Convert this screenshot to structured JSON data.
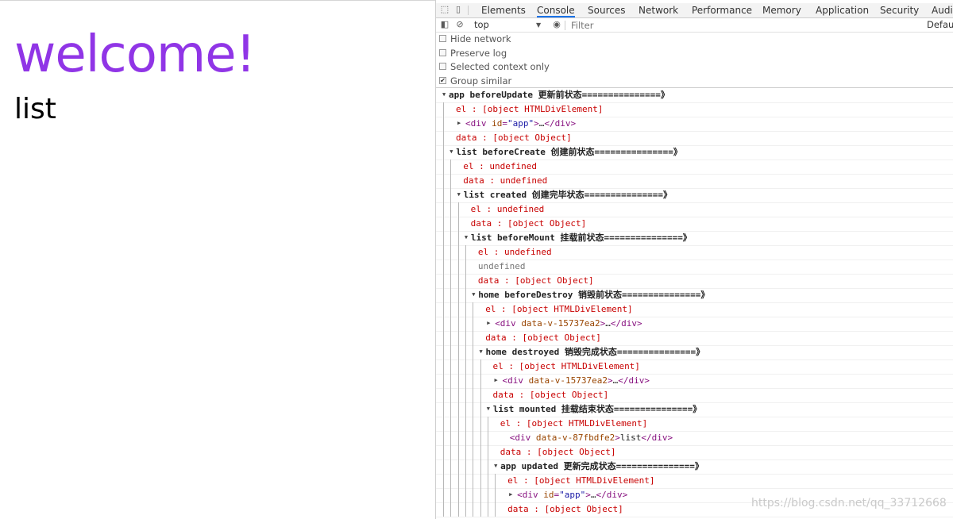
{
  "page": {
    "heading": "welcome!",
    "subtext": "list"
  },
  "devtools": {
    "tabs": [
      {
        "label": "Elements",
        "active": false
      },
      {
        "label": "Console",
        "active": true
      },
      {
        "label": "Sources",
        "active": false
      },
      {
        "label": "Network",
        "active": false
      },
      {
        "label": "Performance",
        "active": false
      },
      {
        "label": "Memory",
        "active": false
      },
      {
        "label": "Application",
        "active": false
      },
      {
        "label": "Security",
        "active": false
      },
      {
        "label": "Audits",
        "active": false
      }
    ],
    "toolbar": {
      "context": "top",
      "filter_placeholder": "Filter",
      "levels": "Default levels"
    },
    "settings": [
      {
        "label": "Hide network",
        "checked": false
      },
      {
        "label": "Preserve log",
        "checked": false
      },
      {
        "label": "Selected context only",
        "checked": false
      },
      {
        "label": "Group similar",
        "checked": true
      }
    ],
    "log": [
      {
        "depth": 0,
        "kind": "group",
        "text": "app beforeUpdate 更新前状态===============》"
      },
      {
        "depth": 1,
        "kind": "red",
        "text": "el     : [object HTMLDivElement]"
      },
      {
        "depth": 1,
        "kind": "node",
        "collapsed": true,
        "attr_name": "id",
        "attr_value": "\"app\"",
        "inner": "…"
      },
      {
        "depth": 1,
        "kind": "red",
        "text": "data   : [object Object]"
      },
      {
        "depth": 1,
        "kind": "group",
        "text": "list beforeCreate 创建前状态===============》"
      },
      {
        "depth": 2,
        "kind": "red",
        "text": "el     : undefined"
      },
      {
        "depth": 2,
        "kind": "red",
        "text": "data   : undefined"
      },
      {
        "depth": 2,
        "kind": "group",
        "text": "list created 创建完毕状态===============》"
      },
      {
        "depth": 3,
        "kind": "red",
        "text": "el     : undefined"
      },
      {
        "depth": 3,
        "kind": "red",
        "text": "data   : [object Object]"
      },
      {
        "depth": 3,
        "kind": "group",
        "text": "list beforeMount 挂载前状态===============》"
      },
      {
        "depth": 4,
        "kind": "red",
        "text": "el     : undefined"
      },
      {
        "depth": 4,
        "kind": "gray",
        "text": "undefined"
      },
      {
        "depth": 4,
        "kind": "red",
        "text": "data   : [object Object]"
      },
      {
        "depth": 4,
        "kind": "group",
        "text": "home beforeDestroy 销毁前状态===============》"
      },
      {
        "depth": 5,
        "kind": "red",
        "text": "el     : [object HTMLDivElement]"
      },
      {
        "depth": 5,
        "kind": "node",
        "collapsed": true,
        "attr_name": "data-v-15737ea2",
        "attr_value": "",
        "inner": "…"
      },
      {
        "depth": 5,
        "kind": "red",
        "text": "data   : [object Object]"
      },
      {
        "depth": 5,
        "kind": "group",
        "text": "home destroyed 销毁完成状态===============》"
      },
      {
        "depth": 6,
        "kind": "red",
        "text": "el     : [object HTMLDivElement]"
      },
      {
        "depth": 6,
        "kind": "node",
        "collapsed": true,
        "attr_name": "data-v-15737ea2",
        "attr_value": "",
        "inner": "…"
      },
      {
        "depth": 6,
        "kind": "red",
        "text": "data   : [object Object]"
      },
      {
        "depth": 6,
        "kind": "group",
        "text": " list mounted 挂载结束状态===============》"
      },
      {
        "depth": 7,
        "kind": "red",
        "text": "el     : [object HTMLDivElement]"
      },
      {
        "depth": 7,
        "kind": "node",
        "collapsed": false,
        "attr_name": "data-v-87fbdfe2",
        "attr_value": "",
        "inner": "list"
      },
      {
        "depth": 7,
        "kind": "red",
        "text": "data   : [object Object]"
      },
      {
        "depth": 7,
        "kind": "group",
        "text": "app updated 更新完成状态===============》"
      },
      {
        "depth": 8,
        "kind": "red",
        "text": "el     : [object HTMLDivElement]"
      },
      {
        "depth": 8,
        "kind": "node",
        "collapsed": true,
        "attr_name": "id",
        "attr_value": "\"app\"",
        "inner": "…"
      },
      {
        "depth": 8,
        "kind": "red",
        "text": "data   : [object Object]"
      }
    ]
  },
  "watermark": "https://blog.csdn.net/qq_33712668"
}
